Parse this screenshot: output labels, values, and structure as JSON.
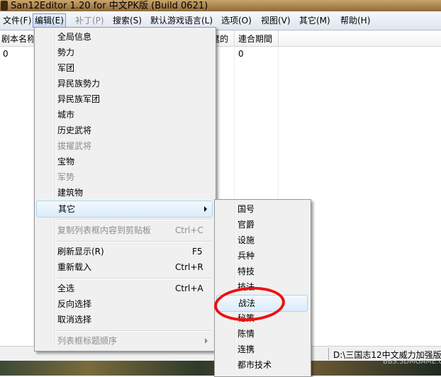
{
  "window": {
    "title": "San12Editor 1.20 for 中文PK版 (Build 0621)"
  },
  "menubar": {
    "items": [
      {
        "label": "文件(F)"
      },
      {
        "label": "编辑(E)"
      },
      {
        "label": "补丁(P)"
      },
      {
        "label": "搜索(S)"
      },
      {
        "label": "默认游戏语言(L)"
      },
      {
        "label": "选项(O)"
      },
      {
        "label": "视图(V)"
      },
      {
        "label": "其它(M)"
      },
      {
        "label": "帮助(H)"
      }
    ]
  },
  "listview": {
    "headers": [
      "剧本名称",
      "麾的",
      "連合期間"
    ],
    "rows": [
      [
        "0",
        "0"
      ]
    ]
  },
  "edit_menu": {
    "items": [
      {
        "label": "全局信息",
        "disabled": false
      },
      {
        "label": "勢力",
        "disabled": false
      },
      {
        "label": "军团",
        "disabled": false
      },
      {
        "label": "异民族勢力",
        "disabled": false
      },
      {
        "label": "异民族军团",
        "disabled": false
      },
      {
        "label": "城市",
        "disabled": false
      },
      {
        "label": "历史武将",
        "disabled": false
      },
      {
        "label": "拔擢武将",
        "disabled": true
      },
      {
        "label": "宝物",
        "disabled": false
      },
      {
        "label": "军势",
        "disabled": true
      },
      {
        "label": "建筑物",
        "disabled": false
      },
      {
        "label": "其它",
        "disabled": false,
        "submenu": true,
        "highlighted": true
      },
      {
        "label": "复制列表框内容到剪贴板",
        "shortcut": "Ctrl+C",
        "disabled": true
      },
      {
        "label": "刷新显示(R)",
        "shortcut": "F5",
        "disabled": false
      },
      {
        "label": "重新载入",
        "shortcut": "Ctrl+R",
        "disabled": false
      },
      {
        "label": "全选",
        "shortcut": "Ctrl+A",
        "disabled": false
      },
      {
        "label": "反向选择",
        "disabled": false
      },
      {
        "label": "取消选择",
        "disabled": false
      },
      {
        "label": "列表框标题顺序",
        "disabled": true,
        "submenu": true
      }
    ]
  },
  "other_submenu": {
    "items": [
      {
        "label": "国号"
      },
      {
        "label": "官爵"
      },
      {
        "label": "设施"
      },
      {
        "label": "兵种"
      },
      {
        "label": "特技"
      },
      {
        "label": "技法"
      },
      {
        "label": "战法",
        "highlighted": true
      },
      {
        "label": "秘策"
      },
      {
        "label": "陈情"
      },
      {
        "label": "连携"
      },
      {
        "label": "都市技术"
      }
    ]
  },
  "statusbar": {
    "path": "D:\\三国志12中文威力加强版"
  },
  "watermark": "BBS.3DMGAME.COM",
  "colors": {
    "highlight_border": "#a8d8eb",
    "annotation_red": "#ee1111"
  }
}
